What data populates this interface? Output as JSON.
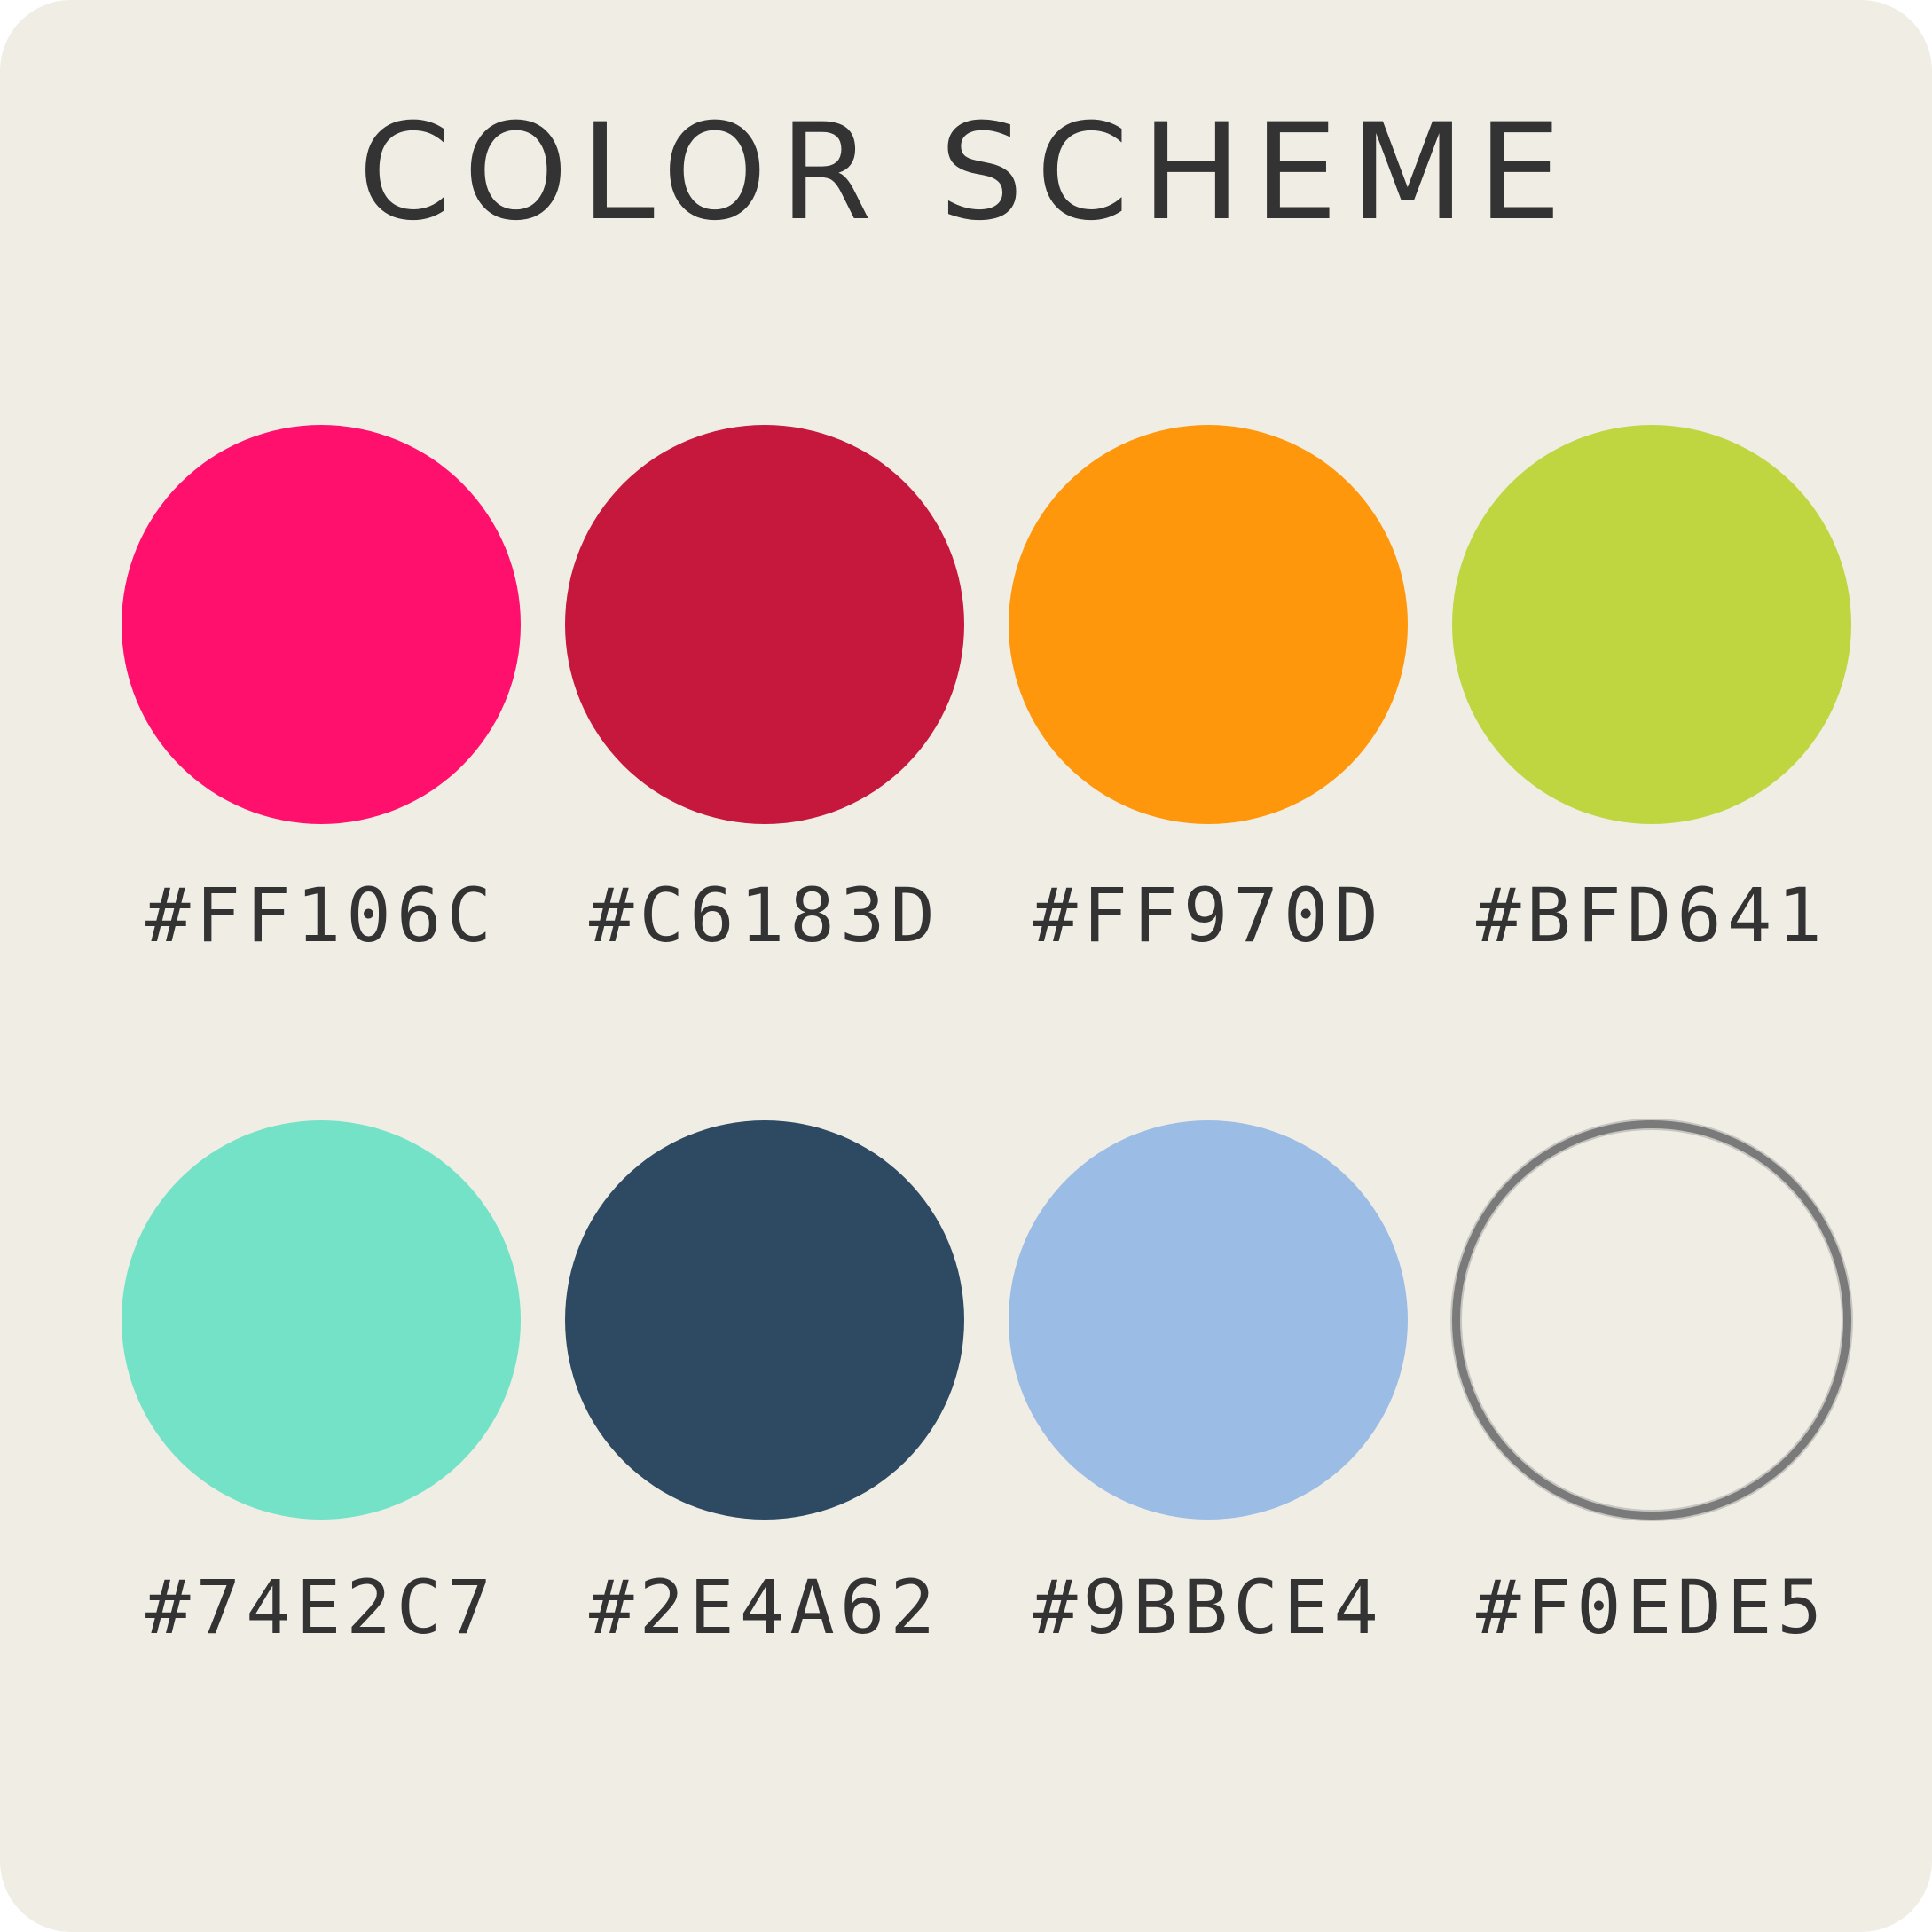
{
  "title": "COLOR SCHEME",
  "colors": [
    {
      "hex": "#FF106C",
      "label": "#FF106C"
    },
    {
      "hex": "#C6183D",
      "label": "#C6183D"
    },
    {
      "hex": "#FF970D",
      "label": "#FF970D"
    },
    {
      "hex": "#BFD641",
      "label": "#BFD641"
    },
    {
      "hex": "#74E2C7",
      "label": "#74E2C7"
    },
    {
      "hex": "#2E4A62",
      "label": "#2E4A62"
    },
    {
      "hex": "#9BBCE4",
      "label": "#9BBCE4"
    },
    {
      "hex": "#F0EDE5",
      "label": "#F0EDE5"
    }
  ],
  "background": "#F0EDE5",
  "text_color": "#333333",
  "outline_color": "#7A7A7A"
}
